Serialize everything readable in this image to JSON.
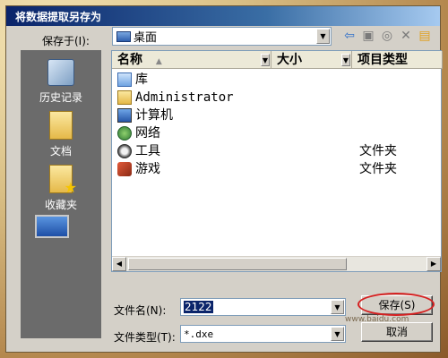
{
  "window": {
    "title": "将数据提取另存为"
  },
  "savein": {
    "label": "保存于(I):",
    "value": "桌面"
  },
  "places": [
    {
      "label": "历史记录",
      "icon": "history-icon"
    },
    {
      "label": "文档",
      "icon": "documents-folder-icon"
    },
    {
      "label": "收藏夹",
      "icon": "favorites-folder-icon"
    },
    {
      "label": "",
      "icon": "desktop-icon"
    }
  ],
  "columns": {
    "name": "名称",
    "size": "大小",
    "type": "项目类型"
  },
  "files": [
    {
      "name": "库",
      "type": "",
      "icon": "library-icon"
    },
    {
      "name": "Administrator",
      "type": "",
      "icon": "user-folder-icon"
    },
    {
      "name": "计算机",
      "type": "",
      "icon": "computer-icon"
    },
    {
      "name": "网络",
      "type": "",
      "icon": "network-icon"
    },
    {
      "name": "工具",
      "type": "文件夹",
      "icon": "tools-folder-icon"
    },
    {
      "name": "游戏",
      "type": "文件夹",
      "icon": "games-folder-icon"
    }
  ],
  "filename": {
    "label": "文件名(N):",
    "value": "2122"
  },
  "filetype": {
    "label": "文件类型(T):",
    "value": "*.dxe"
  },
  "buttons": {
    "save": "保存(S)",
    "cancel": "取消"
  },
  "watermark": "www.baidu.com",
  "colors": {
    "highlight": "#d52020",
    "titlebar": "#0a246a"
  }
}
